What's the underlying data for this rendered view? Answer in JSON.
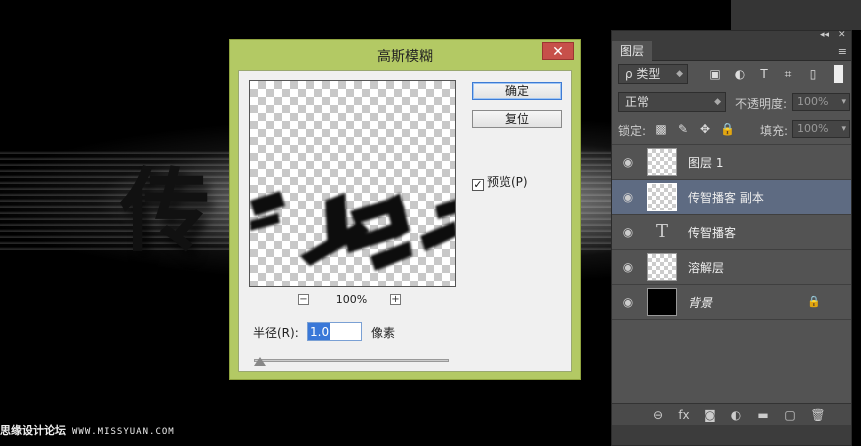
{
  "dialog": {
    "title": "高斯模糊",
    "close_glyph": "✕",
    "ok_label": "确定",
    "reset_label": "复位",
    "preview_checked": true,
    "preview_label": "预览(P)",
    "zoom_level": "100%",
    "zoom_out_glyph": "−",
    "zoom_in_glyph": "+",
    "radius_label": "半径(R):",
    "radius_value": "1.0",
    "radius_unit": "像素",
    "slider_fraction": 0.03
  },
  "canvas": {
    "glyph": "传"
  },
  "layers_panel": {
    "collapse_glyph": "◂◂",
    "close_glyph": "✕",
    "tab_label": "图层",
    "menu_glyph": "≡",
    "filter_kind": "ρ 类型",
    "blend_mode": "正常",
    "opacity_label": "不透明度:",
    "opacity_value": "100%",
    "lock_label": "锁定:",
    "fill_label": "填充:",
    "fill_value": "100%",
    "filter_icons": [
      "image-filter-icon",
      "adjustment-filter-icon",
      "type-filter-icon",
      "shape-filter-icon",
      "smart-object-filter-icon"
    ],
    "filter_glyphs": [
      "▣",
      "◐",
      "T",
      "⌗",
      "▯"
    ],
    "lock_icons": [
      "lock-transparent-icon",
      "lock-paint-icon",
      "lock-move-icon",
      "lock-all-icon"
    ],
    "lock_glyphs": [
      "▩",
      "✎",
      "✥",
      "🔒"
    ],
    "layers": [
      {
        "name": "图层 1",
        "thumb": "checker",
        "selected": false,
        "locked": false
      },
      {
        "name": "传智播客 副本",
        "thumb": "checker",
        "selected": true,
        "locked": false
      },
      {
        "name": "传智播客",
        "thumb": "text",
        "selected": false,
        "locked": false
      },
      {
        "name": "溶解层",
        "thumb": "checker",
        "selected": false,
        "locked": false
      },
      {
        "name": "背景",
        "thumb": "black",
        "selected": false,
        "locked": true
      }
    ],
    "footer_icons": [
      "link-icon",
      "fx-icon",
      "mask-icon",
      "adjustment-icon",
      "folder-icon",
      "new-layer-icon",
      "trash-icon"
    ],
    "footer_glyphs": [
      "⊖",
      "fx",
      "◙",
      "◐",
      "▬",
      "▢",
      "🗑"
    ]
  },
  "watermark": {
    "text_a": "思缘设计论坛",
    "text_b": "WWW.MISSYUAN.COM"
  },
  "colors": {
    "dialog_frame": "#b3c964",
    "close_button": "#c7504a",
    "selected_layer": "#5e6b82",
    "panel_bg": "#535353"
  }
}
